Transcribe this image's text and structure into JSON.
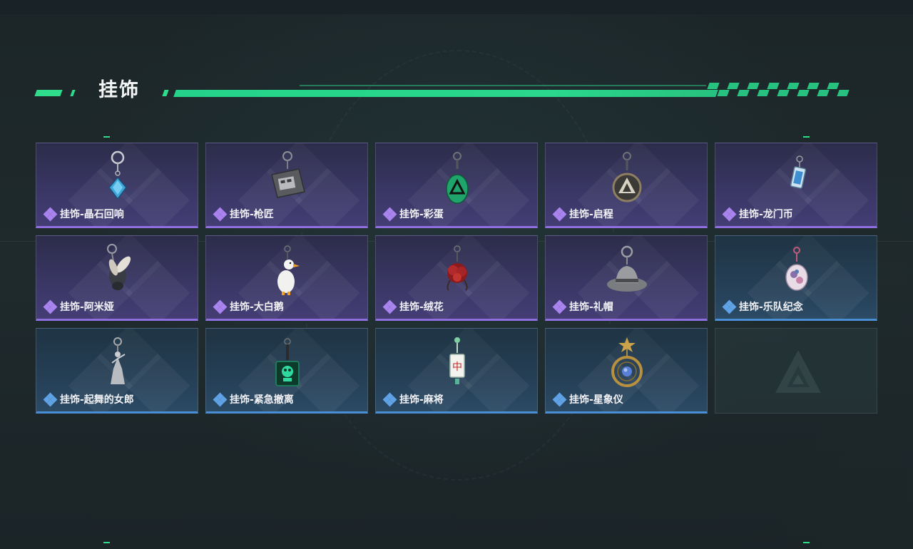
{
  "header": {
    "title": "挂饰"
  },
  "colors": {
    "accent": "#2fdc8c",
    "purple_rarity": "#8f6ee0",
    "blue_rarity": "#4a8fd6"
  },
  "items": [
    {
      "label": "挂饰-晶石回响",
      "rarity": "purple",
      "icon": "crystal-charm-icon"
    },
    {
      "label": "挂饰-枪匠",
      "rarity": "purple",
      "icon": "gunsmith-charm-icon"
    },
    {
      "label": "挂饰-彩蛋",
      "rarity": "purple",
      "icon": "easter-egg-charm-icon"
    },
    {
      "label": "挂饰-启程",
      "rarity": "purple",
      "icon": "departure-charm-icon"
    },
    {
      "label": "挂饰-龙门币",
      "rarity": "purple",
      "icon": "lungmen-coin-charm-icon"
    },
    {
      "label": "挂饰-阿米娅",
      "rarity": "purple",
      "icon": "amiya-charm-icon"
    },
    {
      "label": "挂饰-大白鹅",
      "rarity": "purple",
      "icon": "goose-charm-icon"
    },
    {
      "label": "挂饰-绒花",
      "rarity": "purple",
      "icon": "velvet-flower-charm-icon"
    },
    {
      "label": "挂饰-礼帽",
      "rarity": "purple",
      "icon": "fedora-charm-icon"
    },
    {
      "label": "挂饰-乐队纪念",
      "rarity": "blue",
      "icon": "band-badge-charm-icon"
    },
    {
      "label": "挂饰-起舞的女郎",
      "rarity": "blue",
      "icon": "dancing-lady-charm-icon"
    },
    {
      "label": "挂饰-紧急撤离",
      "rarity": "blue",
      "icon": "emergency-evac-charm-icon"
    },
    {
      "label": "挂饰-麻将",
      "rarity": "blue",
      "icon": "mahjong-charm-icon"
    },
    {
      "label": "挂饰-星象仪",
      "rarity": "blue",
      "icon": "astrolabe-charm-icon"
    }
  ],
  "empty_slot": {
    "icon": "game-logo-icon"
  }
}
